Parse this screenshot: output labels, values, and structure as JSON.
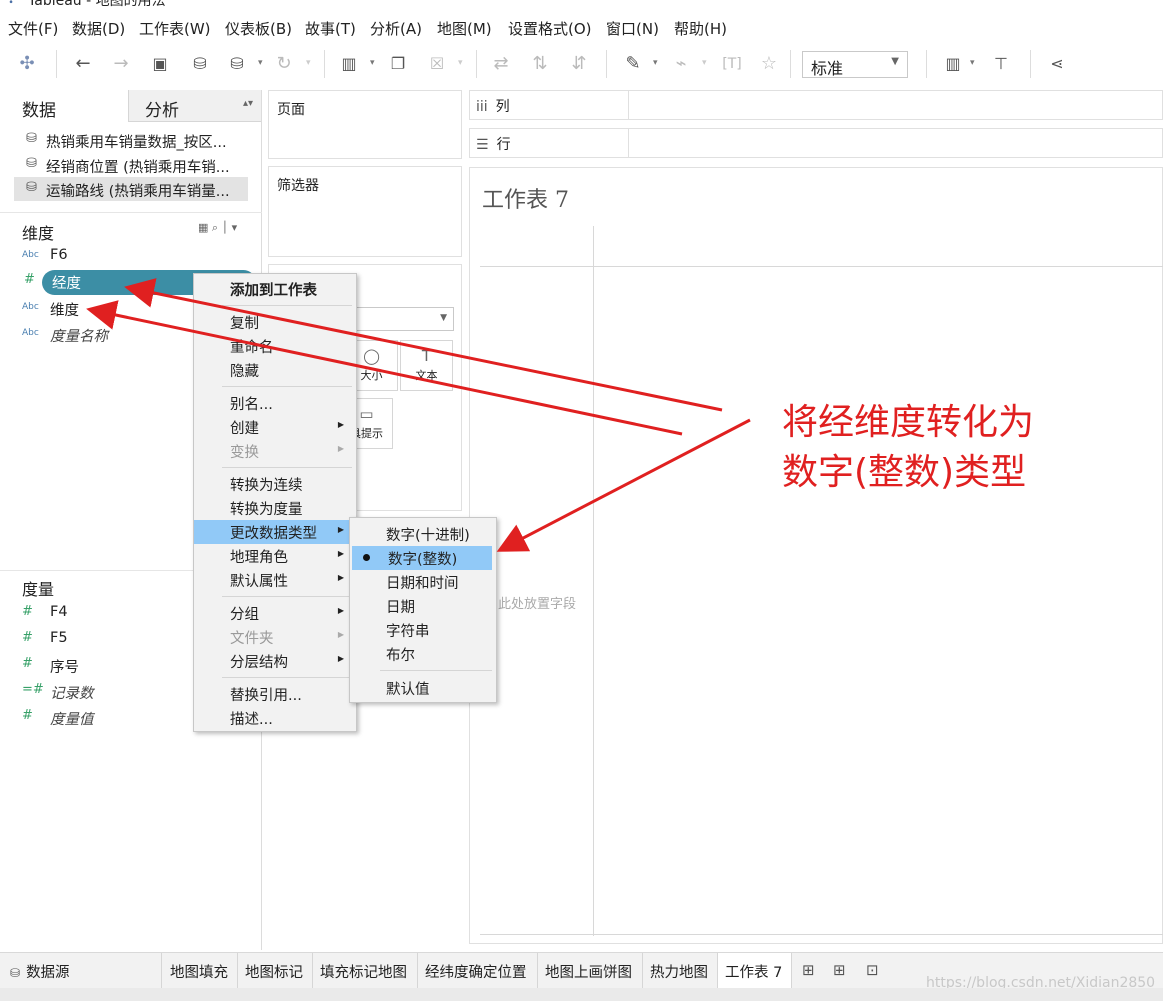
{
  "window": {
    "title": "Tableau - 地图的用法"
  },
  "menubar": [
    {
      "label": "文件(F)"
    },
    {
      "label": "数据(D)"
    },
    {
      "label": "工作表(W)"
    },
    {
      "label": "仪表板(B)"
    },
    {
      "label": "故事(T)"
    },
    {
      "label": "分析(A)"
    },
    {
      "label": "地图(M)"
    },
    {
      "label": "设置格式(O)"
    },
    {
      "label": "窗口(N)"
    },
    {
      "label": "帮助(H)"
    }
  ],
  "toolbar": {
    "fit_select": "标准"
  },
  "left_panel": {
    "tabs": {
      "data": "数据",
      "analysis": "分析"
    },
    "data_sources": [
      {
        "label": "热销乘用车销量数据_按区..."
      },
      {
        "label": "经销商位置 (热销乘用车销..."
      },
      {
        "label": "运输路线 (热销乘用车销量..."
      }
    ],
    "dimensions_title": "维度",
    "dimensions": [
      {
        "type": "Abc",
        "label": "F6"
      },
      {
        "type": "#",
        "label": "经度"
      },
      {
        "type": "Abc",
        "label": "维度"
      },
      {
        "type": "Abc",
        "label": "度量名称"
      }
    ],
    "measures_title": "度量",
    "measures": [
      {
        "type": "#",
        "label": "F4"
      },
      {
        "type": "#",
        "label": "F5"
      },
      {
        "type": "#",
        "label": "序号"
      },
      {
        "type": "=#",
        "label": "记录数"
      },
      {
        "type": "#",
        "label": "度量值"
      }
    ]
  },
  "shelves": {
    "pages": "页面",
    "filters": "筛选器",
    "columns": "列",
    "rows": "行",
    "marks": {
      "size": "大小",
      "text": "文本",
      "tooltip": "具提示"
    }
  },
  "worksheet": {
    "title": "工作表 7",
    "drop_hint": "此处放置字段"
  },
  "context_menu": {
    "items": [
      {
        "label": "添加到工作表"
      },
      {
        "label": "复制"
      },
      {
        "label": "重命名"
      },
      {
        "label": "隐藏"
      },
      {
        "label": "别名..."
      },
      {
        "label": "创建"
      },
      {
        "label": "变换"
      },
      {
        "label": "转换为连续"
      },
      {
        "label": "转换为度量"
      },
      {
        "label": "更改数据类型"
      },
      {
        "label": "地理角色"
      },
      {
        "label": "默认属性"
      },
      {
        "label": "分组"
      },
      {
        "label": "文件夹"
      },
      {
        "label": "分层结构"
      },
      {
        "label": "替换引用..."
      },
      {
        "label": "描述..."
      }
    ]
  },
  "submenu": {
    "items": [
      {
        "label": "数字(十进制)"
      },
      {
        "label": "数字(整数)",
        "selected": true
      },
      {
        "label": "日期和时间"
      },
      {
        "label": "日期"
      },
      {
        "label": "字符串"
      },
      {
        "label": "布尔"
      },
      {
        "label": "默认值"
      }
    ]
  },
  "annotation": {
    "line1": "将经维度转化为",
    "line2": "数字(整数)类型",
    "color": "#e02020"
  },
  "bottom_tabs": [
    {
      "label": "数据源"
    },
    {
      "label": "地图填充"
    },
    {
      "label": "地图标记"
    },
    {
      "label": "填充标记地图"
    },
    {
      "label": "经纬度确定位置"
    },
    {
      "label": "地图上画饼图"
    },
    {
      "label": "热力地图"
    },
    {
      "label": "工作表 7",
      "active": true
    }
  ],
  "watermark": "https://blog.csdn.net/Xidian2850"
}
